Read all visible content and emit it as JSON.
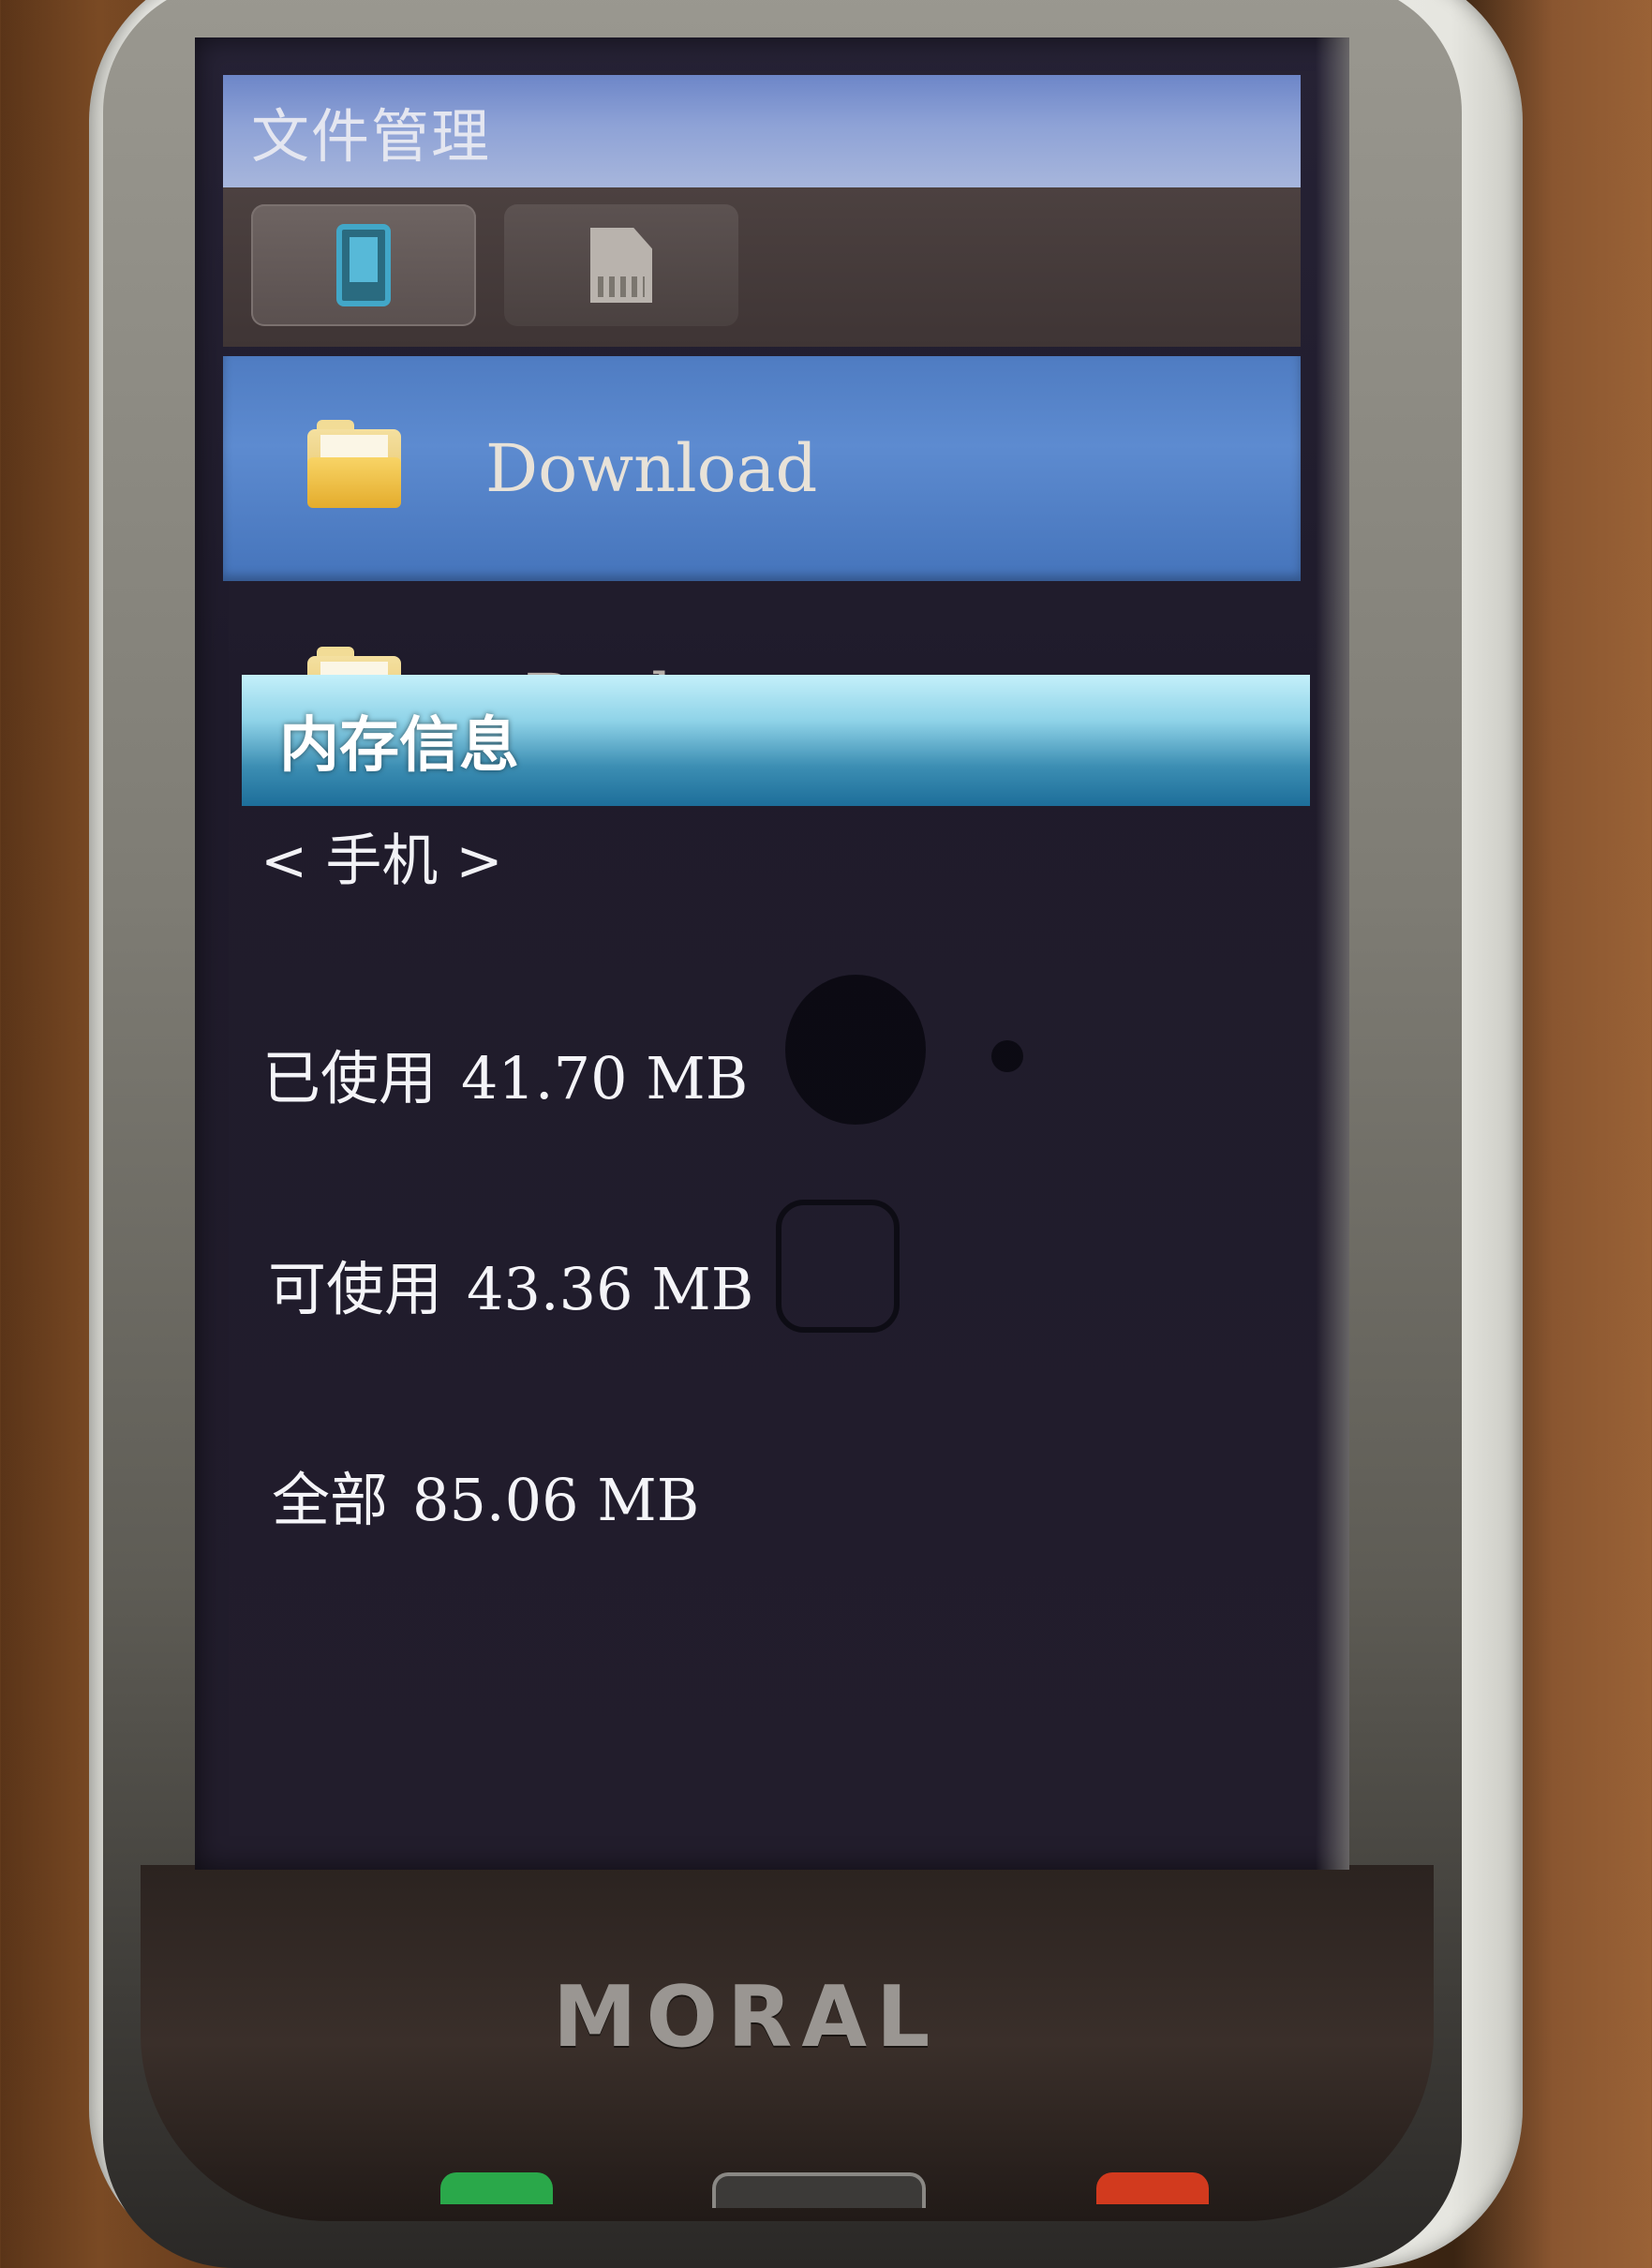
{
  "device": {
    "brand": "MORAL"
  },
  "screen": {
    "title": "文件管理",
    "tabs": [
      {
        "icon": "phone-icon",
        "selected": true
      },
      {
        "icon": "memory-card-icon",
        "selected": false
      }
    ],
    "file_list": [
      {
        "label": "Download",
        "icon": "folder-icon",
        "selected": true
      },
      {
        "label": "eBook",
        "icon": "folder-icon",
        "selected": false
      }
    ]
  },
  "memory_info": {
    "title": "内存信息",
    "storage_selector": "< 手机 >",
    "rows": [
      {
        "label": "已使用",
        "value": "41.70 MB"
      },
      {
        "label": "可使用",
        "value": "43.36 MB"
      },
      {
        "label": "全部",
        "value": "85.06 MB"
      }
    ]
  },
  "colors": {
    "title_bar": "#8ea2d6",
    "selected_item": "#5d8bd0",
    "info_header": "#3c8eb3",
    "screen_bg": "#221d2c"
  }
}
